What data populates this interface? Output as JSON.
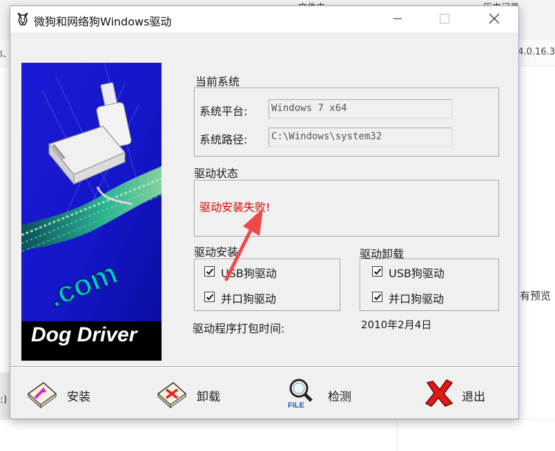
{
  "background": {
    "tab_text_1": "文件夹",
    "tab_text_2": "历史记录",
    "row_left_fragment": "l、",
    "row_version_fragment": "4.0.16.3",
    "side_text": "没有预览",
    "left_fragment": ":)"
  },
  "window": {
    "title": "微狗和网络狗Windows驱动",
    "minimize_icon": "minimize-icon",
    "maximize_icon": "maximize-icon",
    "close_icon": "close-icon"
  },
  "side_image": {
    "caption": "Dog Driver",
    "domain_text": ".com"
  },
  "current_system": {
    "group_label": "当前系统",
    "platform_label": "系统平台:",
    "platform_value": "Windows 7 x64",
    "path_label": "系统路径:",
    "path_value": "C:\\Windows\\system32"
  },
  "driver_status": {
    "group_label": "驱动状态",
    "message": "驱动安装失败!",
    "message_color": "#e00000"
  },
  "driver_install": {
    "group_label": "驱动安装",
    "options": [
      {
        "label": "USB狗驱动",
        "checked": true
      },
      {
        "label": "并口狗驱动",
        "checked": true
      }
    ]
  },
  "driver_uninstall": {
    "group_label": "驱动卸载",
    "options": [
      {
        "label": "USB狗驱动",
        "checked": true
      },
      {
        "label": "并口狗驱动",
        "checked": true
      }
    ]
  },
  "package_time": {
    "label": "驱动程序打包时间:",
    "value": "2010年2月4日"
  },
  "toolbar": {
    "install_label": "安装",
    "uninstall_label": "卸载",
    "detect_label": "检测",
    "detect_icon_text": "FILE",
    "exit_label": "退出"
  },
  "annotation": {
    "arrow_color": "#f04848"
  }
}
